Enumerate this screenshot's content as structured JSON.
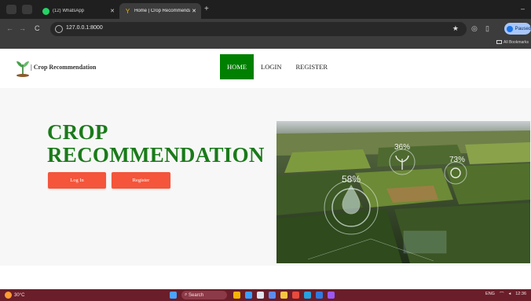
{
  "browser": {
    "tabs": [
      {
        "title": "(12) WhatsApp",
        "active": false
      },
      {
        "title": "Home | Crop Recommendation",
        "active": true
      }
    ],
    "new_tab": "+",
    "url": "127.0.0.1:8000",
    "profile_label": "Paused",
    "bookmarks_label": "All Bookmarks"
  },
  "site": {
    "brand": "| Crop Recommendation",
    "nav": [
      {
        "label": "HOME",
        "active": true
      },
      {
        "label": "LOGIN",
        "active": false
      },
      {
        "label": "REGISTER",
        "active": false
      }
    ],
    "hero": {
      "title_line1": "CROP",
      "title_line2": "RECOMMENDATION",
      "login_button": "Log In",
      "register_button": "Register"
    },
    "image_overlay": {
      "value_left": "58%",
      "value_center": "36%",
      "value_right": "73%"
    }
  },
  "taskbar": {
    "weather": "30°C",
    "search_placeholder": "Search",
    "language": "ENG",
    "time": "12:36"
  },
  "colors": {
    "accent_green": "#008000",
    "title_green": "#1a7a1a",
    "button_orange": "#f4553b",
    "taskbar": "#6a1e2a"
  }
}
